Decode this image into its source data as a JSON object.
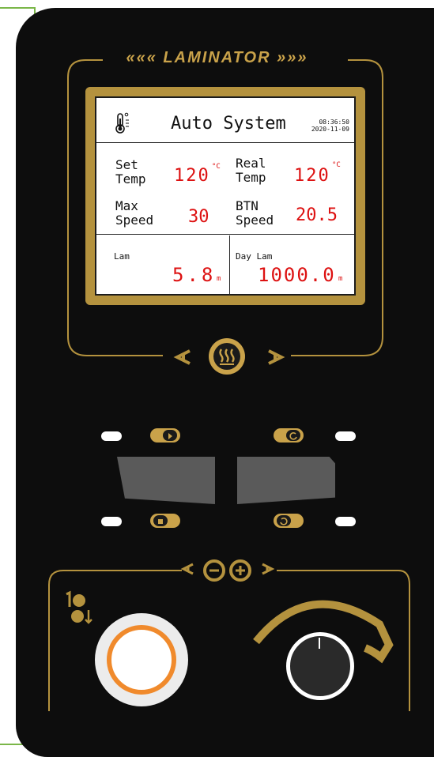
{
  "device": {
    "brand": "LAMINATOR"
  },
  "screen": {
    "title": "Auto System",
    "time": "08:36:50",
    "date": "2020-11-09",
    "thermo_icon": "thermometer-icon",
    "set_temp": {
      "label_1": "Set",
      "label_2": "Temp",
      "value": "120",
      "unit": "°C"
    },
    "real_temp": {
      "label_1": "Real",
      "label_2": "Temp",
      "value": "120",
      "unit": "°C"
    },
    "max_speed": {
      "label_1": "Max",
      "label_2": "Speed",
      "value": "30"
    },
    "btn_speed": {
      "label_1": "BTN",
      "label_2": "Speed",
      "value": "20.5"
    },
    "lam": {
      "label": "Lam",
      "value": "5.8",
      "unit": "m"
    },
    "day_lam": {
      "label": "Day Lam",
      "value": "1000.0",
      "unit": "m"
    }
  },
  "controls": {
    "heat_icon": "heat-waves-icon",
    "buttons": [
      {
        "name": "forward-play-icon",
        "position": "top-left"
      },
      {
        "name": "reverse-rotate-icon",
        "position": "top-right"
      },
      {
        "name": "stop-icon",
        "position": "bottom-left"
      },
      {
        "name": "clockwise-rotate-icon",
        "position": "bottom-right"
      }
    ],
    "speed_knob_icon": "minus-plus-rotate-icon",
    "roller_icon": "roller-pressure-icon"
  },
  "colors": {
    "panel": "#0d0d0d",
    "gold": "#b4923e",
    "display_value": "#dd1111",
    "emergency_ring": "#f08a2c",
    "frame_green": "#7ab648"
  }
}
